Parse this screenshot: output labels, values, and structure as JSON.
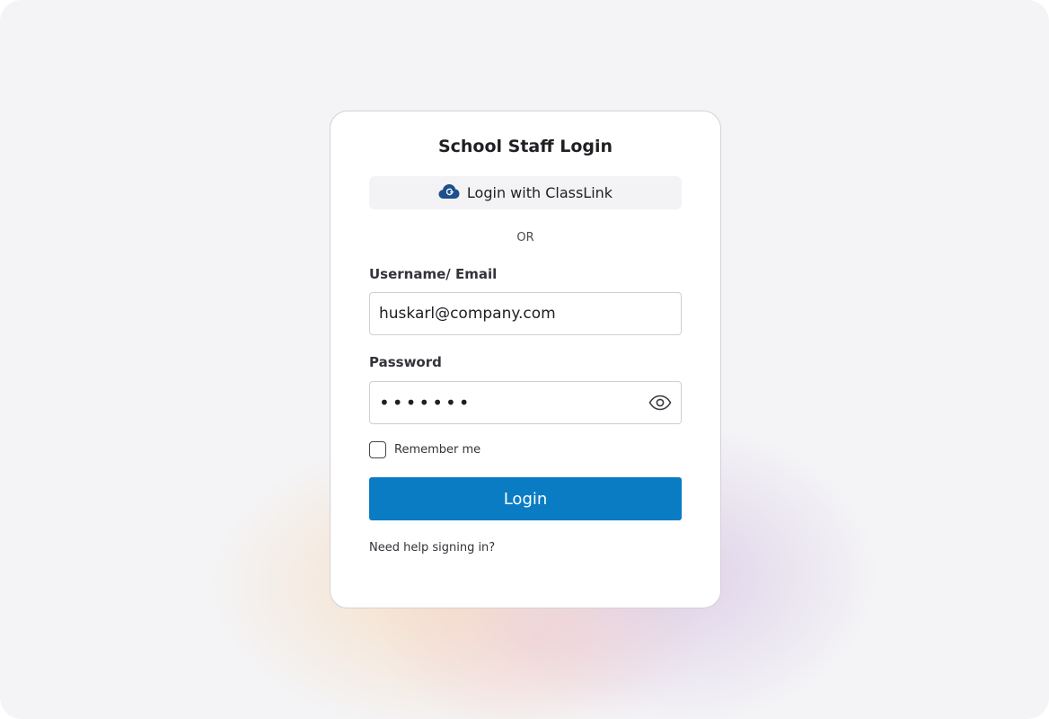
{
  "login_card": {
    "title": "School Staff Login",
    "classlink_button": {
      "label": "Login with ClassLink",
      "icon": "classlink-cloud-icon",
      "icon_color": "#1d4f8c"
    },
    "separator": "OR",
    "username": {
      "label": "Username/ Email",
      "value": "huskarl@company.com"
    },
    "password": {
      "label": "Password",
      "value": "•••••••",
      "toggle_icon": "eye-icon"
    },
    "remember_me": {
      "label": "Remember me",
      "checked": false
    },
    "login_button": {
      "label": "Login",
      "color": "#0a7cc3"
    },
    "help_link": "Need help signing in?"
  }
}
